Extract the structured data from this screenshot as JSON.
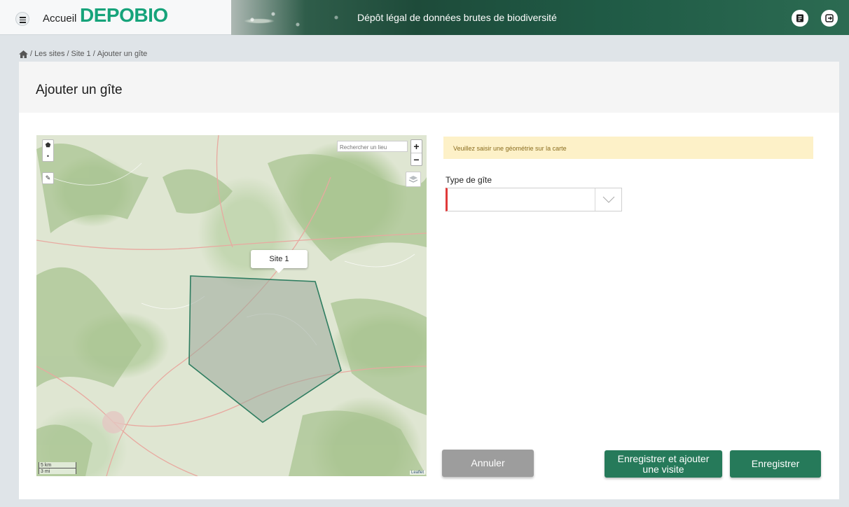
{
  "header": {
    "menu_icon": "hamburger-icon",
    "home_label": "Accueil",
    "logo_text": "DEPOBIO",
    "banner_title": "Dépôt légal de données brutes de biodiversité",
    "doc_button_icon": "document-icon",
    "logout_button_icon": "logout-icon"
  },
  "breadcrumb": {
    "home_icon": "home-icon",
    "items": [
      "Les sites",
      "Site 1",
      "Ajouter un gîte"
    ],
    "separator": "/"
  },
  "page": {
    "title": "Ajouter un gîte"
  },
  "map": {
    "search_placeholder": "Rechercher un lieu",
    "zoom_in": "+",
    "zoom_out": "−",
    "polygon_tooltip": "Site 1",
    "scale_km": "5 km",
    "scale_mi": "3 mi",
    "attribution": "Leaflet",
    "polygon_color": "#2e7d60"
  },
  "form": {
    "warning_text": "Veuillez saisir une géométrie sur la carte",
    "type_label": "Type de gîte",
    "type_value": ""
  },
  "buttons": {
    "cancel": "Annuler",
    "save_and_add_visit_line1": "Enregistrer et ajouter",
    "save_and_add_visit_line2": "une visite",
    "save": "Enregistrer"
  },
  "colors": {
    "brand": "#16a37a",
    "primary_button": "#267a5a",
    "cancel_button": "#9d9d9d",
    "warning_bg": "#fdf1c8",
    "required_marker": "#e03a3a"
  }
}
